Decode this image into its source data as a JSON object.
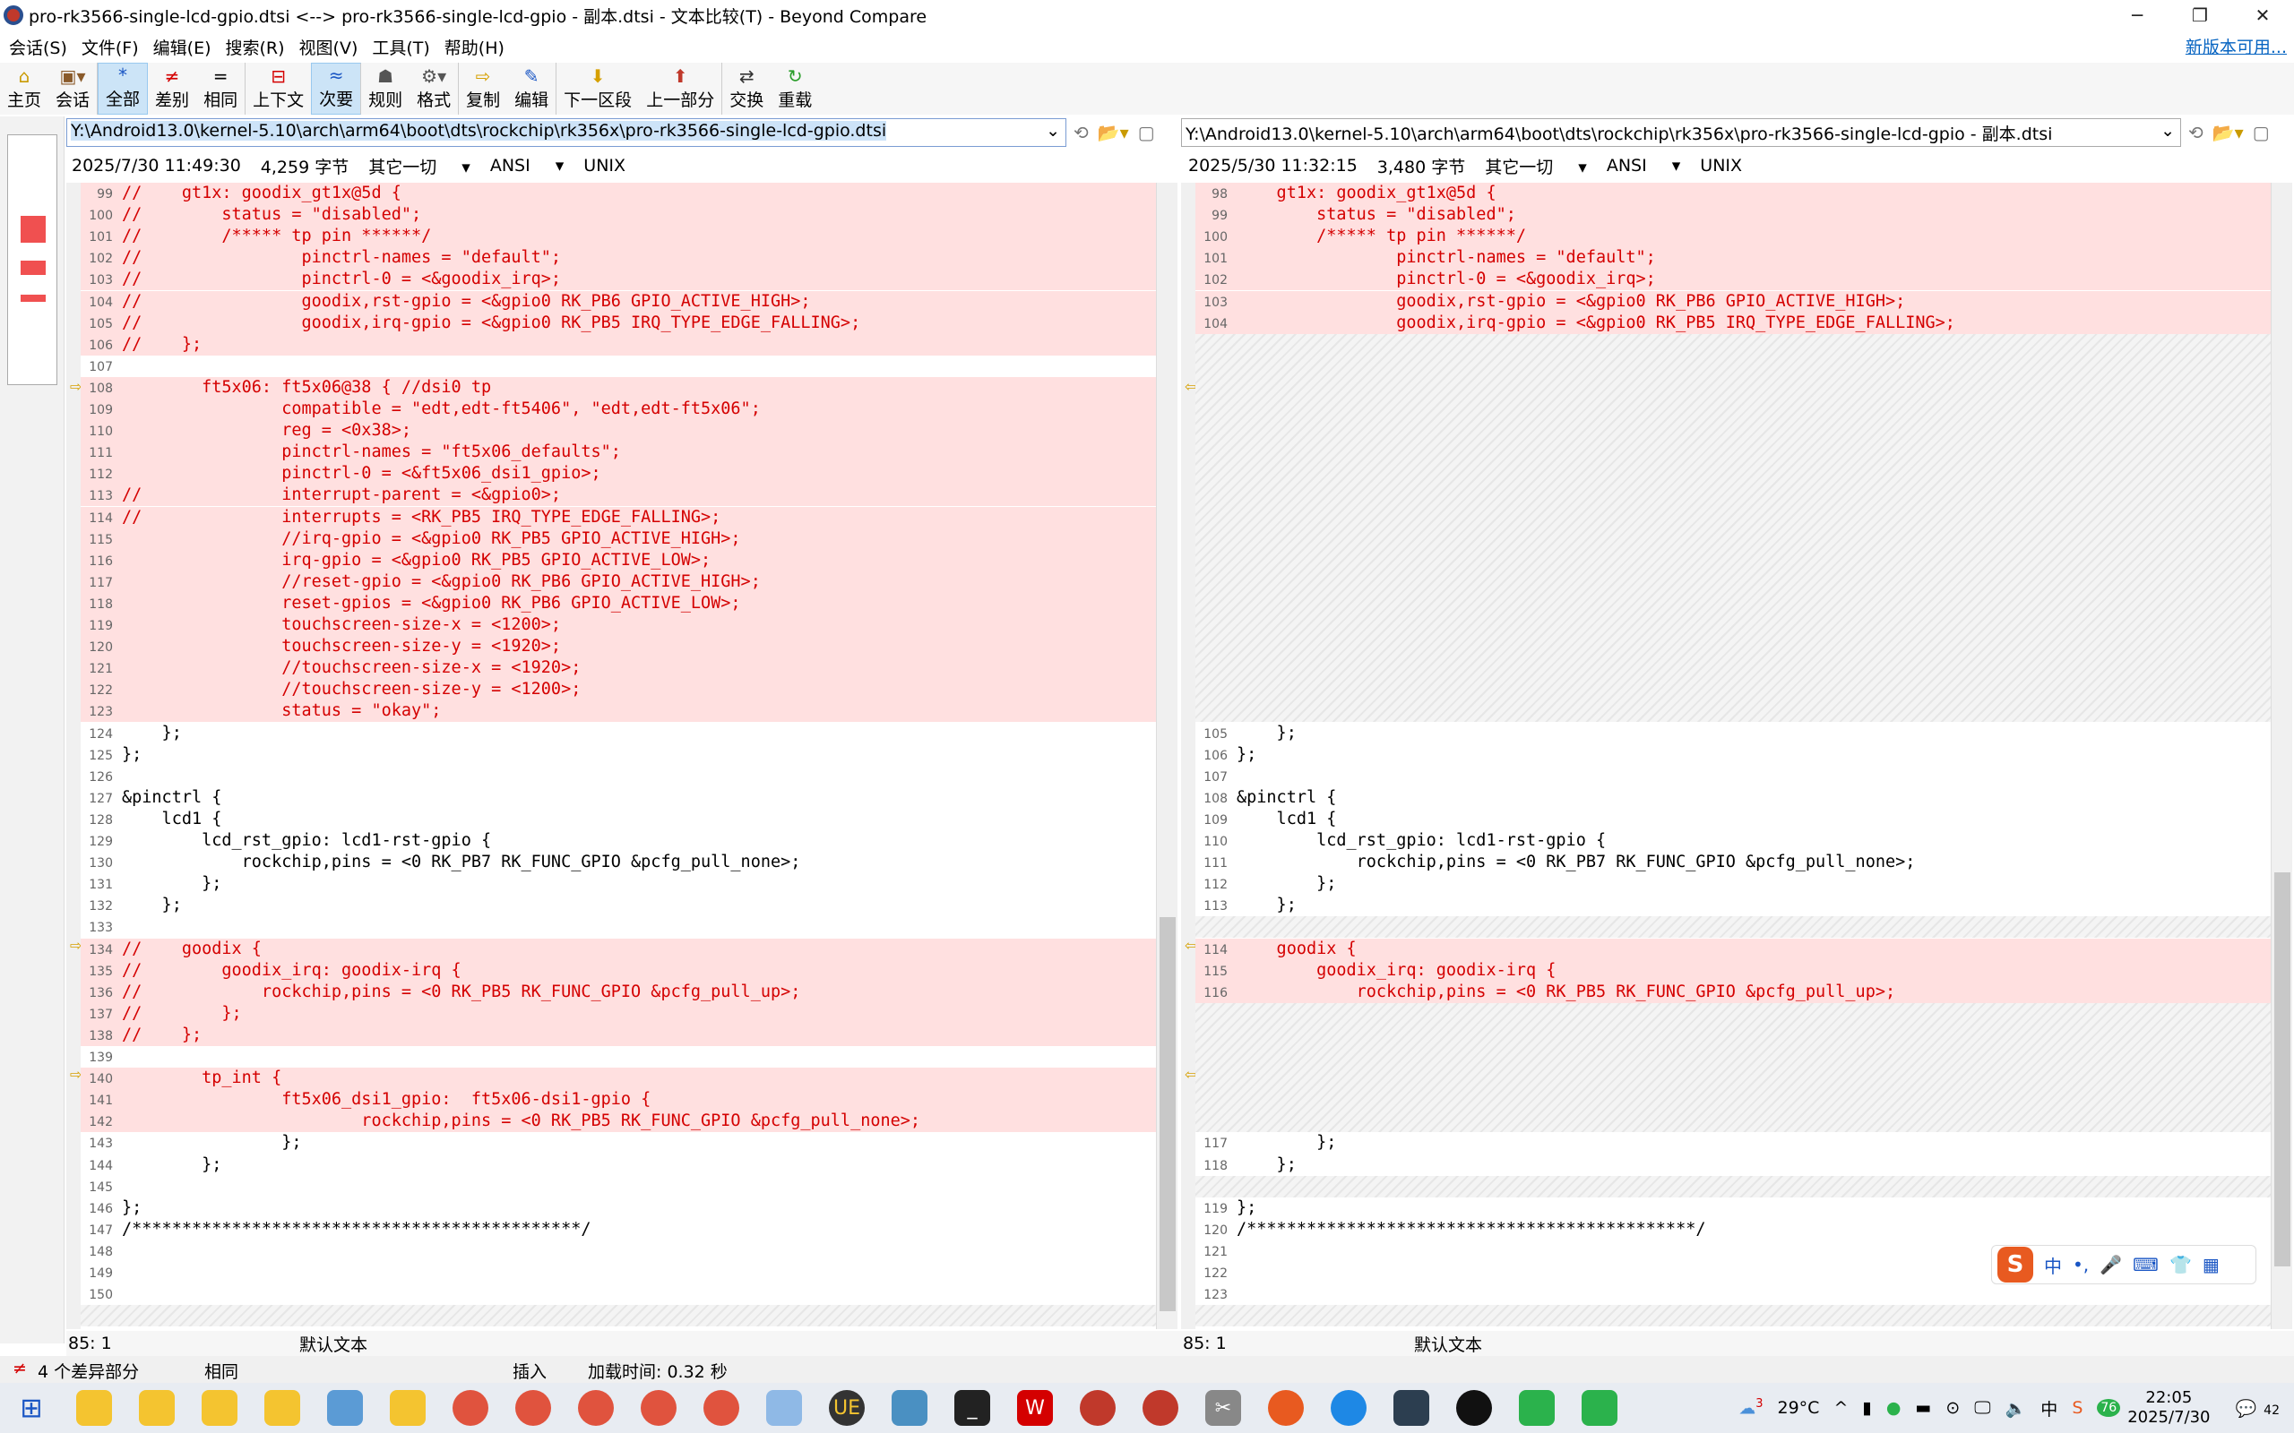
{
  "window": {
    "title": "pro-rk3566-single-lcd-gpio.dtsi <--> pro-rk3566-single-lcd-gpio - 副本.dtsi - 文本比较(T) - Beyond Compare"
  },
  "menu": [
    "会话(S)",
    "文件(F)",
    "编辑(E)",
    "搜索(R)",
    "视图(V)",
    "工具(T)",
    "帮助(H)"
  ],
  "new_version": "新版本可用...",
  "toolbar": [
    {
      "label": "主页",
      "icon": "home-icon"
    },
    {
      "label": "会话",
      "icon": "session-icon"
    },
    {
      "label": "全部",
      "icon": "all-icon"
    },
    {
      "label": "差别",
      "icon": "diff-icon"
    },
    {
      "label": "相同",
      "icon": "same-icon"
    },
    {
      "label": "上下文",
      "icon": "context-icon"
    },
    {
      "label": "次要",
      "icon": "minor-icon"
    },
    {
      "label": "规则",
      "icon": "rules-icon"
    },
    {
      "label": "格式",
      "icon": "format-icon"
    },
    {
      "label": "复制",
      "icon": "copy-icon"
    },
    {
      "label": "编辑",
      "icon": "edit-icon"
    },
    {
      "label": "下一区段",
      "icon": "next-section-icon"
    },
    {
      "label": "上一部分",
      "icon": "prev-section-icon"
    },
    {
      "label": "交换",
      "icon": "swap-icon"
    },
    {
      "label": "重载",
      "icon": "reload-icon"
    }
  ],
  "left": {
    "path": "Y:\\Android13.0\\kernel-5.10\\arch\\arm64\\boot\\dts\\rockchip\\rk356x\\pro-rk3566-single-lcd-gpio.dtsi",
    "date": "2025/7/30 11:49:30",
    "size": "4,259 字节",
    "filter": "其它一切",
    "encoding": "ANSI",
    "eol": "UNIX",
    "cursor": "85: 1",
    "text_mode": "默认文本",
    "lines": [
      {
        "n": "99",
        "t": "//    gt1x: goodix_gt1x@5d {",
        "d": true
      },
      {
        "n": "100",
        "t": "//        status = \"disabled\";",
        "d": true
      },
      {
        "n": "101",
        "t": "//        /***** tp pin ******/",
        "d": true
      },
      {
        "n": "102",
        "t": "//                pinctrl-names = \"default\";",
        "d": true
      },
      {
        "n": "103",
        "t": "//                pinctrl-0 = <&goodix_irq>;",
        "d": true
      },
      {
        "n": "104",
        "t": "//                goodix,rst-gpio = <&gpio0 RK_PB6 GPIO_ACTIVE_HIGH>;",
        "d": true
      },
      {
        "n": "105",
        "t": "//                goodix,irq-gpio = <&gpio0 RK_PB5 IRQ_TYPE_EDGE_FALLING>;",
        "d": true
      },
      {
        "n": "106",
        "t": "//    };",
        "d": true
      },
      {
        "n": "107",
        "t": "",
        "d": false
      },
      {
        "n": "108",
        "t": "        ft5x06: ft5x06@38 { //dsi0 tp",
        "d": true
      },
      {
        "n": "109",
        "t": "                compatible = \"edt,edt-ft5406\", \"edt,edt-ft5x06\";",
        "d": true
      },
      {
        "n": "110",
        "t": "                reg = <0x38>;",
        "d": true
      },
      {
        "n": "111",
        "t": "                pinctrl-names = \"ft5x06_defaults\";",
        "d": true
      },
      {
        "n": "112",
        "t": "                pinctrl-0 = <&ft5x06_dsi1_gpio>;",
        "d": true
      },
      {
        "n": "113",
        "t": "//              interrupt-parent = <&gpio0>;",
        "d": true
      },
      {
        "n": "114",
        "t": "//              interrupts = <RK_PB5 IRQ_TYPE_EDGE_FALLING>;",
        "d": true
      },
      {
        "n": "115",
        "t": "                //irq-gpio = <&gpio0 RK_PB5 GPIO_ACTIVE_HIGH>;",
        "d": true
      },
      {
        "n": "116",
        "t": "                irq-gpio = <&gpio0 RK_PB5 GPIO_ACTIVE_LOW>;",
        "d": true
      },
      {
        "n": "117",
        "t": "                //reset-gpio = <&gpio0 RK_PB6 GPIO_ACTIVE_HIGH>;",
        "d": true
      },
      {
        "n": "118",
        "t": "                reset-gpios = <&gpio0 RK_PB6 GPIO_ACTIVE_LOW>;",
        "d": true
      },
      {
        "n": "119",
        "t": "                touchscreen-size-x = <1200>;",
        "d": true
      },
      {
        "n": "120",
        "t": "                touchscreen-size-y = <1920>;",
        "d": true
      },
      {
        "n": "121",
        "t": "                //touchscreen-size-x = <1920>;",
        "d": true
      },
      {
        "n": "122",
        "t": "                //touchscreen-size-y = <1200>;",
        "d": true
      },
      {
        "n": "123",
        "t": "                status = \"okay\";",
        "d": true
      },
      {
        "n": "124",
        "t": "    };",
        "d": false
      },
      {
        "n": "125",
        "t": "};",
        "d": false
      },
      {
        "n": "126",
        "t": "",
        "d": false
      },
      {
        "n": "127",
        "t": "&pinctrl {",
        "d": false
      },
      {
        "n": "128",
        "t": "    lcd1 {",
        "d": false
      },
      {
        "n": "129",
        "t": "        lcd_rst_gpio: lcd1-rst-gpio {",
        "d": false
      },
      {
        "n": "130",
        "t": "            rockchip,pins = <0 RK_PB7 RK_FUNC_GPIO &pcfg_pull_none>;",
        "d": false
      },
      {
        "n": "131",
        "t": "        };",
        "d": false
      },
      {
        "n": "132",
        "t": "    };",
        "d": false
      },
      {
        "n": "133",
        "t": "",
        "d": false
      },
      {
        "n": "134",
        "t": "//    goodix {",
        "d": true
      },
      {
        "n": "135",
        "t": "//        goodix_irq: goodix-irq {",
        "d": true
      },
      {
        "n": "136",
        "t": "//            rockchip,pins = <0 RK_PB5 RK_FUNC_GPIO &pcfg_pull_up>;",
        "d": true
      },
      {
        "n": "137",
        "t": "//        };",
        "d": true
      },
      {
        "n": "138",
        "t": "//    };",
        "d": true
      },
      {
        "n": "139",
        "t": "",
        "d": false
      },
      {
        "n": "140",
        "t": "        tp_int {",
        "d": true
      },
      {
        "n": "141",
        "t": "                ft5x06_dsi1_gpio:  ft5x06-dsi1-gpio {",
        "d": true
      },
      {
        "n": "142",
        "t": "                        rockchip,pins = <0 RK_PB5 RK_FUNC_GPIO &pcfg_pull_none>;",
        "d": true
      },
      {
        "n": "143",
        "t": "                };",
        "d": false
      },
      {
        "n": "144",
        "t": "        };",
        "d": false
      },
      {
        "n": "145",
        "t": "",
        "d": false
      },
      {
        "n": "146",
        "t": "};",
        "d": false
      },
      {
        "n": "147",
        "t": "/*********************************************/",
        "d": false
      },
      {
        "n": "148",
        "t": "",
        "d": false
      },
      {
        "n": "149",
        "t": "",
        "d": false
      },
      {
        "n": "150",
        "t": "",
        "d": false
      }
    ]
  },
  "right": {
    "path": "Y:\\Android13.0\\kernel-5.10\\arch\\arm64\\boot\\dts\\rockchip\\rk356x\\pro-rk3566-single-lcd-gpio - 副本.dtsi",
    "date": "2025/5/30 11:32:15",
    "size": "3,480 字节",
    "filter": "其它一切",
    "encoding": "ANSI",
    "eol": "UNIX",
    "cursor": "85: 1",
    "text_mode": "默认文本",
    "lines": [
      {
        "n": "98",
        "t": "    gt1x: goodix_gt1x@5d {",
        "d": true
      },
      {
        "n": "99",
        "t": "        status = \"disabled\";",
        "d": true
      },
      {
        "n": "100",
        "t": "        /***** tp pin ******/",
        "d": true
      },
      {
        "n": "101",
        "t": "                pinctrl-names = \"default\";",
        "d": true
      },
      {
        "n": "102",
        "t": "                pinctrl-0 = <&goodix_irq>;",
        "d": true
      },
      {
        "n": "103",
        "t": "                goodix,rst-gpio = <&gpio0 RK_PB6 GPIO_ACTIVE_HIGH>;",
        "d": true
      },
      {
        "n": "104",
        "t": "                goodix,irq-gpio = <&gpio0 RK_PB5 IRQ_TYPE_EDGE_FALLING>;",
        "d": true
      },
      {
        "n": "105",
        "t": "    };",
        "d": false
      },
      {
        "n": "106",
        "t": "};",
        "d": false
      },
      {
        "n": "107",
        "t": "",
        "d": false
      },
      {
        "n": "108",
        "t": "&pinctrl {",
        "d": false
      },
      {
        "n": "109",
        "t": "    lcd1 {",
        "d": false
      },
      {
        "n": "110",
        "t": "        lcd_rst_gpio: lcd1-rst-gpio {",
        "d": false
      },
      {
        "n": "111",
        "t": "            rockchip,pins = <0 RK_PB7 RK_FUNC_GPIO &pcfg_pull_none>;",
        "d": false
      },
      {
        "n": "112",
        "t": "        };",
        "d": false
      },
      {
        "n": "113",
        "t": "    };",
        "d": false
      },
      {
        "n": "114",
        "t": "    goodix {",
        "d": true
      },
      {
        "n": "115",
        "t": "        goodix_irq: goodix-irq {",
        "d": true
      },
      {
        "n": "116",
        "t": "            rockchip,pins = <0 RK_PB5 RK_FUNC_GPIO &pcfg_pull_up>;",
        "d": true
      },
      {
        "n": "117",
        "t": "        };",
        "d": false
      },
      {
        "n": "118",
        "t": "    };",
        "d": false
      },
      {
        "n": "119",
        "t": "};",
        "d": false
      },
      {
        "n": "120",
        "t": "/*********************************************/",
        "d": false
      },
      {
        "n": "121",
        "t": "",
        "d": false
      },
      {
        "n": "122",
        "t": "",
        "d": false
      },
      {
        "n": "123",
        "t": "",
        "d": false
      }
    ]
  },
  "status": {
    "diff_count": "4 个差异部分",
    "same": "相同",
    "insert": "插入",
    "load_time": "加载时间: 0.32 秒"
  },
  "ime": {
    "lang": "中"
  },
  "tray": {
    "weather": "29°C",
    "time": "22:05",
    "date": "2025/7/30",
    "notifications": "42",
    "badge": "3",
    "battery": "76"
  }
}
